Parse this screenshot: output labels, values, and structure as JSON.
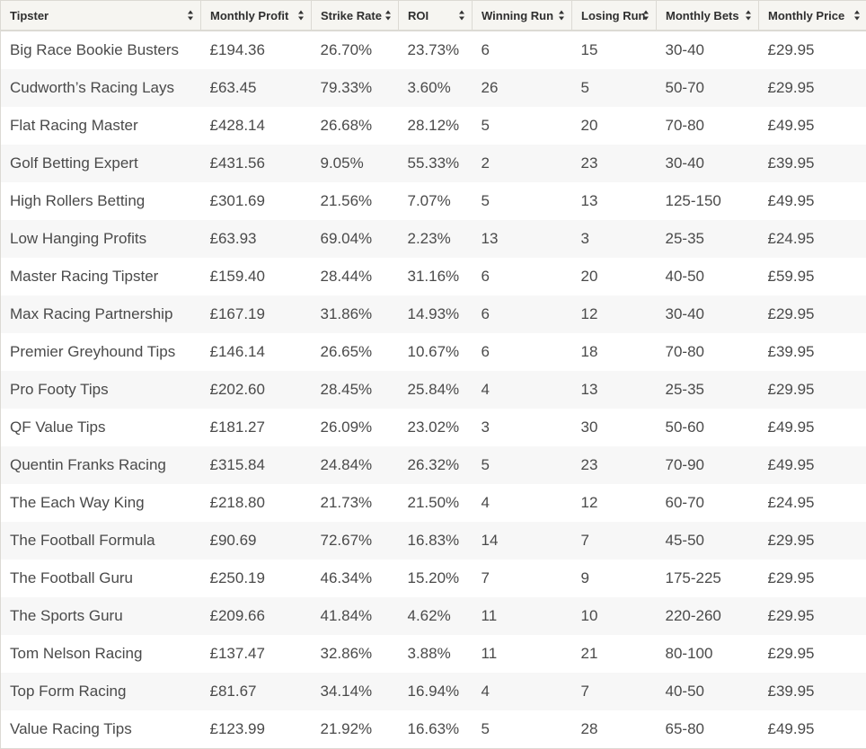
{
  "table": {
    "columns": [
      {
        "label": "Tipster",
        "sortable": true
      },
      {
        "label": "Monthly Profit",
        "sortable": true
      },
      {
        "label": "Strike Rate",
        "sortable": true
      },
      {
        "label": "ROI",
        "sortable": true
      },
      {
        "label": "Winning Run",
        "sortable": true
      },
      {
        "label": "Losing Run",
        "sortable": true
      },
      {
        "label": "Monthly Bets",
        "sortable": true
      },
      {
        "label": "Monthly Price",
        "sortable": true
      }
    ],
    "rows": [
      [
        "Big Race Bookie Busters",
        "£194.36",
        "26.70%",
        "23.73%",
        "6",
        "15",
        "30-40",
        "£29.95"
      ],
      [
        "Cudworth’s Racing Lays",
        "£63.45",
        "79.33%",
        "3.60%",
        "26",
        "5",
        "50-70",
        "£29.95"
      ],
      [
        "Flat Racing Master",
        "£428.14",
        "26.68%",
        "28.12%",
        "5",
        "20",
        "70-80",
        "£49.95"
      ],
      [
        "Golf Betting Expert",
        "£431.56",
        "9.05%",
        "55.33%",
        "2",
        "23",
        "30-40",
        "£39.95"
      ],
      [
        "High Rollers Betting",
        "£301.69",
        "21.56%",
        "7.07%",
        "5",
        "13",
        "125-150",
        "£49.95"
      ],
      [
        "Low Hanging Profits",
        "£63.93",
        "69.04%",
        "2.23%",
        "13",
        "3",
        "25-35",
        "£24.95"
      ],
      [
        "Master Racing Tipster",
        "£159.40",
        "28.44%",
        "31.16%",
        "6",
        "20",
        "40-50",
        "£59.95"
      ],
      [
        "Max Racing Partnership",
        "£167.19",
        "31.86%",
        "14.93%",
        "6",
        "12",
        "30-40",
        "£29.95"
      ],
      [
        "Premier Greyhound Tips",
        "£146.14",
        "26.65%",
        "10.67%",
        "6",
        "18",
        "70-80",
        "£39.95"
      ],
      [
        "Pro Footy Tips",
        "£202.60",
        "28.45%",
        "25.84%",
        "4",
        "13",
        "25-35",
        "£29.95"
      ],
      [
        "QF Value Tips",
        "£181.27",
        "26.09%",
        "23.02%",
        "3",
        "30",
        "50-60",
        "£49.95"
      ],
      [
        "Quentin Franks Racing",
        "£315.84",
        "24.84%",
        "26.32%",
        "5",
        "23",
        "70-90",
        "£49.95"
      ],
      [
        "The Each Way King",
        "£218.80",
        "21.73%",
        "21.50%",
        "4",
        "12",
        "60-70",
        "£24.95"
      ],
      [
        "The Football Formula",
        "£90.69",
        "72.67%",
        "16.83%",
        "14",
        "7",
        "45-50",
        "£29.95"
      ],
      [
        "The Football Guru",
        "£250.19",
        "46.34%",
        "15.20%",
        "7",
        "9",
        "175-225",
        "£29.95"
      ],
      [
        "The Sports Guru",
        "£209.66",
        "41.84%",
        "4.62%",
        "11",
        "10",
        "220-260",
        "£29.95"
      ],
      [
        "Tom Nelson Racing",
        "£137.47",
        "32.86%",
        "3.88%",
        "11",
        "21",
        "80-100",
        "£29.95"
      ],
      [
        "Top Form Racing",
        "£81.67",
        "34.14%",
        "16.94%",
        "4",
        "7",
        "40-50",
        "£39.95"
      ],
      [
        "Value Racing Tips",
        "£123.99",
        "21.92%",
        "16.63%",
        "5",
        "28",
        "65-80",
        "£49.95"
      ]
    ]
  },
  "icons": {
    "sort": "sort-up-down-icon"
  }
}
